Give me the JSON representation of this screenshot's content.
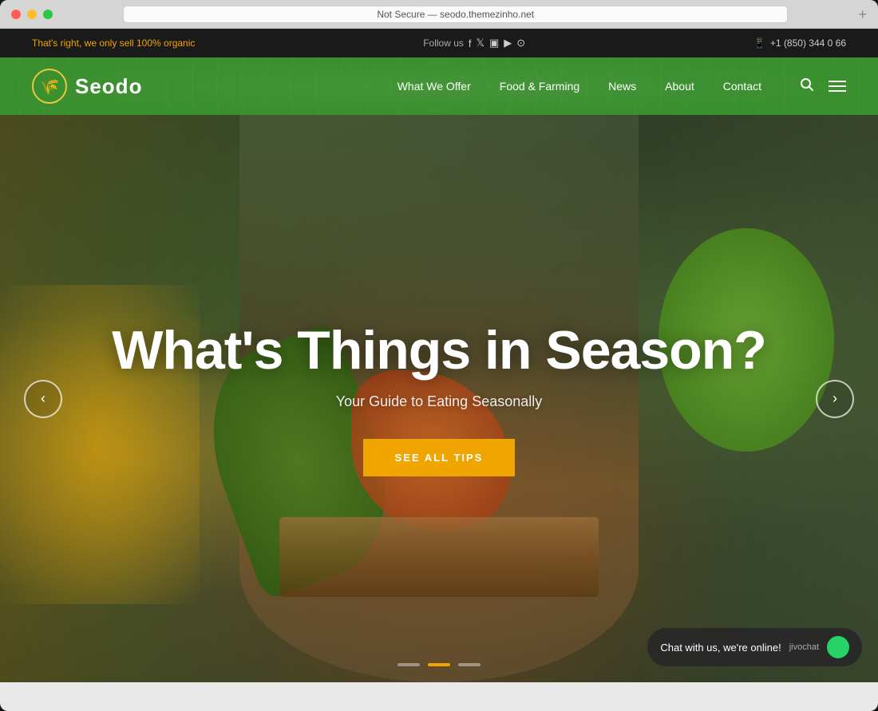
{
  "browser": {
    "url": "Not Secure — seodo.themezinho.net",
    "reload_icon": "↺",
    "plus_icon": "+"
  },
  "topbar": {
    "promo_text": "That's right, we only sell 100% organic",
    "follow_label": "Follow us",
    "social_icons": [
      "f",
      "t",
      "◻",
      "▶",
      "●"
    ],
    "phone": "+1 (850) 344 0 66",
    "phone_icon": "📱"
  },
  "navbar": {
    "logo_icon": "🌾",
    "logo_text": "Seodo",
    "links": [
      {
        "label": "What We Offer"
      },
      {
        "label": "Food & Farming"
      },
      {
        "label": "News"
      },
      {
        "label": "About"
      },
      {
        "label": "Contact"
      }
    ],
    "search_icon": "search",
    "menu_icon": "menu"
  },
  "hero": {
    "title": "What's Things in Season?",
    "subtitle": "Your Guide to Eating Seasonally",
    "cta_button": "SEE ALL TIPS",
    "prev_icon": "‹",
    "next_icon": "›",
    "dots": [
      {
        "active": false
      },
      {
        "active": true
      },
      {
        "active": false
      }
    ]
  },
  "chat": {
    "message": "Chat with us, we're online!",
    "brand": "jivochat"
  }
}
